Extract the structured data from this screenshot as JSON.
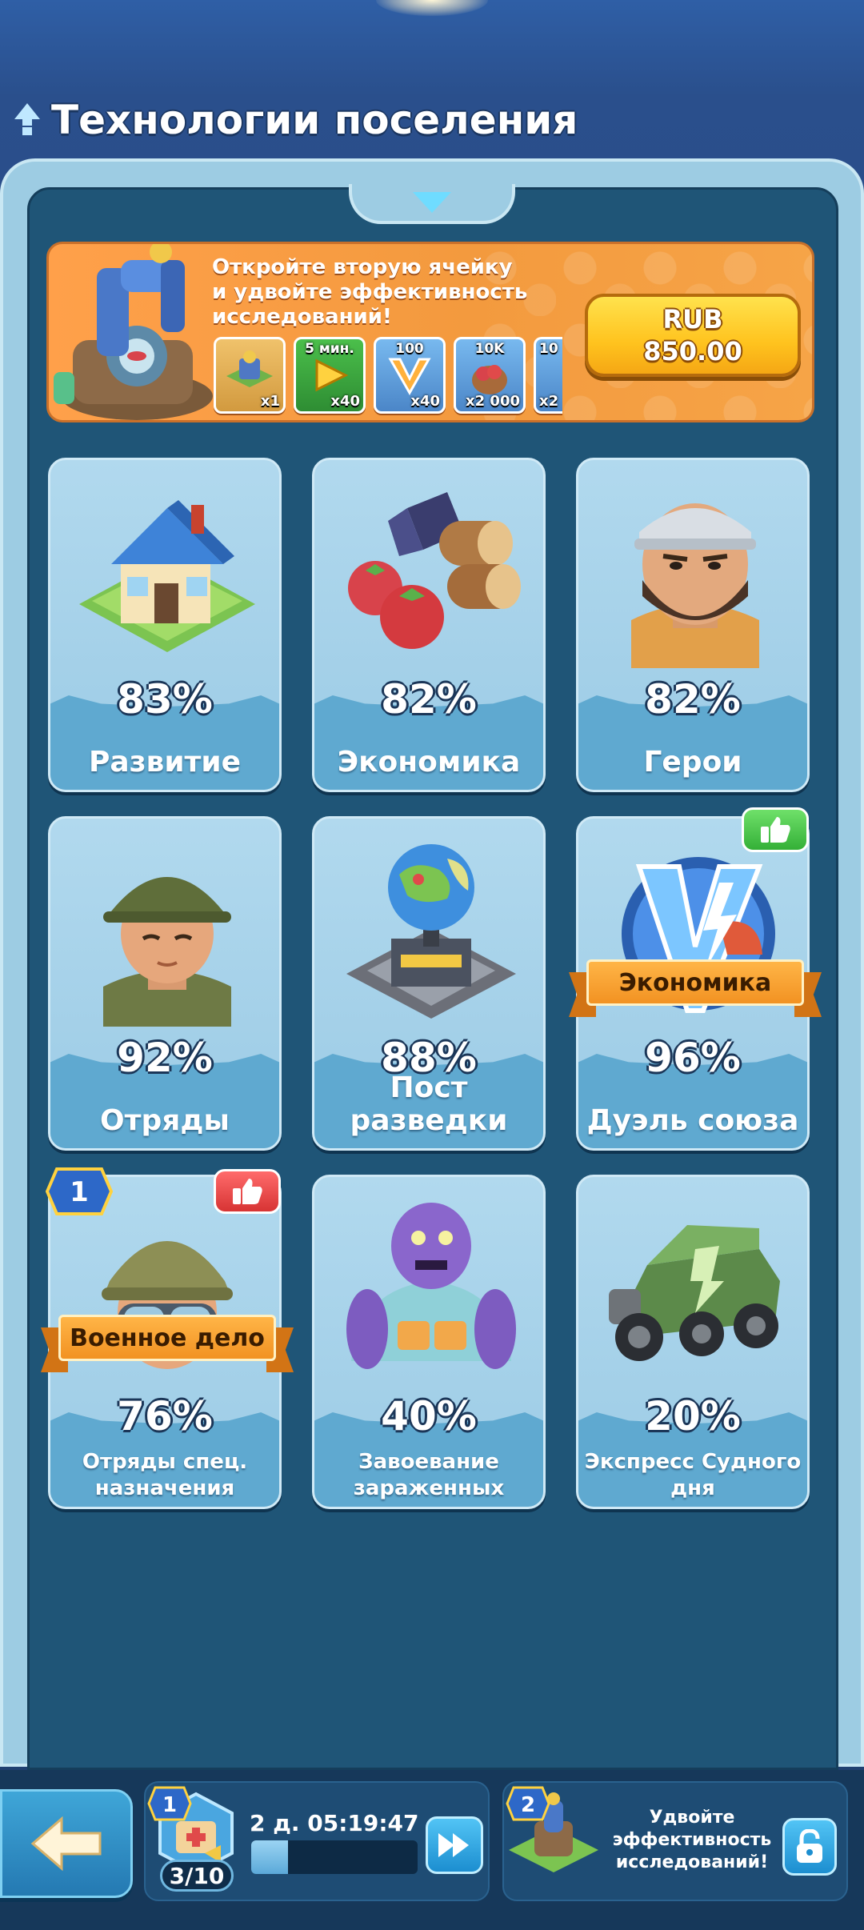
{
  "header": {
    "title": "Технологии поселения"
  },
  "promo": {
    "text": "Откройте вторую ячейку и удвойте эффективность исследований!",
    "rewards": [
      {
        "name": "research-building",
        "qty": "x1",
        "top": ""
      },
      {
        "name": "speedup-5min",
        "qty": "x40",
        "top": "5 мин."
      },
      {
        "name": "v-badge",
        "qty": "x40",
        "top": "100"
      },
      {
        "name": "food-sack",
        "qty": "x2 000",
        "top": "10K"
      },
      {
        "name": "partial-item",
        "qty": "x2",
        "top": "10"
      }
    ],
    "price_currency": "RUB",
    "price_value": "850.00"
  },
  "cards": [
    {
      "label": "Развитие",
      "percent": "83%"
    },
    {
      "label": "Экономика",
      "percent": "82%"
    },
    {
      "label": "Герои",
      "percent": "82%"
    },
    {
      "label": "Отряды",
      "percent": "92%"
    },
    {
      "label": "Пост разведки",
      "percent": "88%"
    },
    {
      "label": "Дуэль союза",
      "percent": "96%",
      "ribbon": "Экономика"
    },
    {
      "label": "Отряды спец. назначения",
      "percent": "76%",
      "ribbon": "Военное дело",
      "badge": "1"
    },
    {
      "label": "Завоевание зараженных",
      "percent": "40%"
    },
    {
      "label": "Экспресс Судного дня",
      "percent": "20%"
    }
  ],
  "bottom": {
    "slot1_badge": "1",
    "timer": "2 д. 05:19:47",
    "progress": 0.22,
    "count": "3/10",
    "slot2_badge": "2",
    "slot2_text": "Удвойте эффективность исследований!"
  },
  "colors": {
    "accent": "#ffc31e",
    "panel": "#1f5577",
    "card": "#9ccbe5"
  }
}
